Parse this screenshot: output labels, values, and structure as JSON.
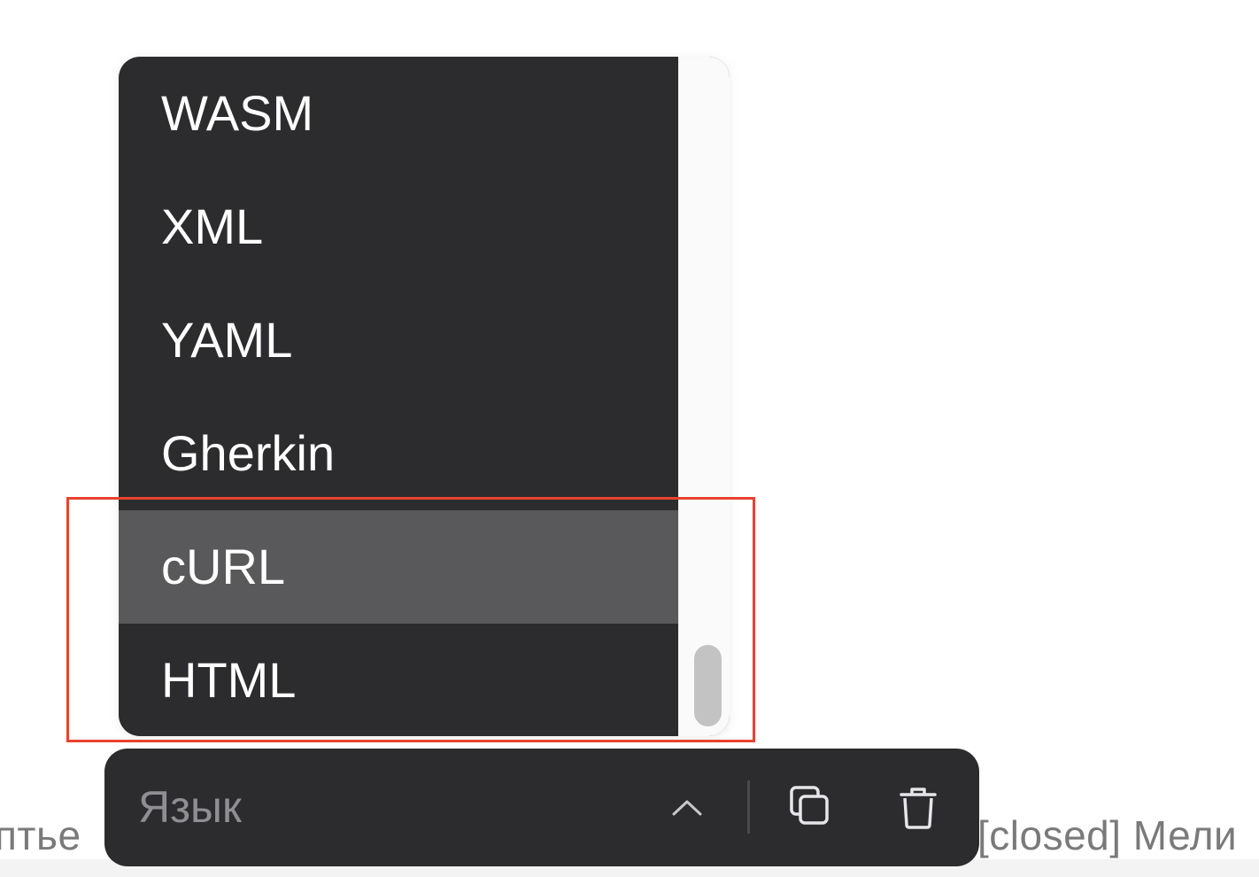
{
  "background_text": {
    "left": "птье",
    "right": "[closed] Мели"
  },
  "dropdown": {
    "options": [
      {
        "label": "WASM",
        "highlighted": false
      },
      {
        "label": "XML",
        "highlighted": false
      },
      {
        "label": "YAML",
        "highlighted": false
      },
      {
        "label": "Gherkin",
        "highlighted": false
      },
      {
        "label": "cURL",
        "highlighted": true
      },
      {
        "label": "HTML",
        "highlighted": false
      }
    ]
  },
  "toolbar": {
    "language_placeholder": "Язык",
    "chevron_icon": "chevron-up-icon",
    "copy_icon": "copy-icon",
    "delete_icon": "trash-icon"
  },
  "colors": {
    "panel_background": "#2c2c2e",
    "highlighted_option": "#59595b",
    "annotation": "#e8432e",
    "scrollbar_thumb": "#c3c3c3"
  }
}
